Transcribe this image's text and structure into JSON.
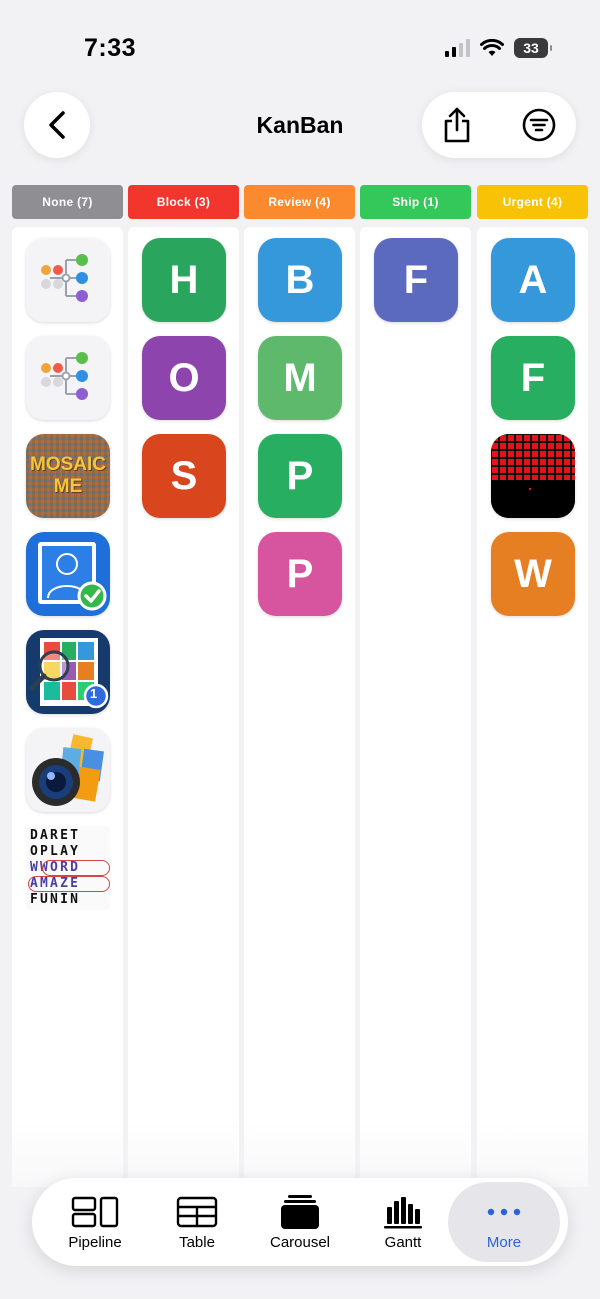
{
  "status": {
    "time": "7:33",
    "battery": "33"
  },
  "nav": {
    "title": "KanBan"
  },
  "columns": [
    {
      "label": "None (7)",
      "color": "#8e8e93"
    },
    {
      "label": "Block (3)",
      "color": "#f2362e"
    },
    {
      "label": "Review (4)",
      "color": "#fb8a2e"
    },
    {
      "label": "Ship (1)",
      "color": "#34c759"
    },
    {
      "label": "Urgent (4)",
      "color": "#f8c307"
    }
  ],
  "none_cards": [
    {
      "icon": "mind-map-app-icon"
    },
    {
      "icon": "mind-map-app-icon"
    },
    {
      "icon": "mosaic-me-app-icon",
      "text_line1": "MOSAIC",
      "text_line2": "ME"
    },
    {
      "icon": "profile-photo-check-app-icon"
    },
    {
      "icon": "collage-search-app-icon",
      "badge": "1"
    },
    {
      "icon": "camera-photos-app-icon"
    },
    {
      "icon": "word-search-app-icon",
      "rows": [
        "DARET",
        "OPLAY",
        "WWORD",
        "AMAZE",
        "FUNIN"
      ]
    }
  ],
  "block_cards": [
    {
      "letter": "H",
      "color": "#2aa55e"
    },
    {
      "letter": "O",
      "color": "#8e44ad"
    },
    {
      "letter": "S",
      "color": "#d9461e"
    }
  ],
  "review_cards": [
    {
      "letter": "B",
      "color": "#3498db"
    },
    {
      "letter": "M",
      "color": "#5fb96c"
    },
    {
      "letter": "P",
      "color": "#27ae60"
    },
    {
      "letter": "P",
      "color": "#d6559e"
    }
  ],
  "ship_cards": [
    {
      "letter": "F",
      "color": "#5b6abf"
    }
  ],
  "urgent_cards": [
    {
      "letter": "A",
      "color": "#3498db"
    },
    {
      "letter": "F",
      "color": "#27ae60"
    },
    {
      "icon": "red-grid-game-icon"
    },
    {
      "letter": "W",
      "color": "#e67e22"
    }
  ],
  "tabs": [
    {
      "label": "Pipeline",
      "icon": "pipeline-icon"
    },
    {
      "label": "Table",
      "icon": "table-icon"
    },
    {
      "label": "Carousel",
      "icon": "carousel-icon"
    },
    {
      "label": "Gantt",
      "icon": "gantt-icon"
    },
    {
      "label": "More",
      "icon": "more-icon",
      "selected": true
    }
  ]
}
